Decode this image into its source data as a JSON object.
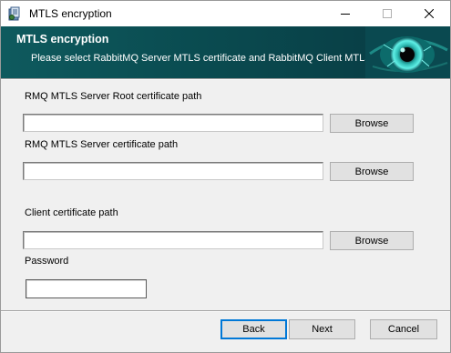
{
  "window": {
    "title": "MTLS encryption",
    "app_icon": "installer-icon",
    "controls": {
      "minimize": "minimize-icon",
      "maximize": "maximize-icon",
      "close": "close-icon"
    }
  },
  "banner": {
    "title": "MTLS encryption",
    "subtitle": "Please select RabbitMQ Server MTLS certificate and  RabbitMQ Client MTLS . .",
    "image": "eye-icon",
    "colors": {
      "background": "#0b5056",
      "accent": "#38e0d8"
    }
  },
  "form": {
    "server_root_cert": {
      "label": "RMQ MTLS Server Root certificate path",
      "value": "",
      "browse_label": "Browse"
    },
    "server_cert": {
      "label": "RMQ MTLS Server certificate path",
      "value": "",
      "browse_label": "Browse"
    },
    "client_cert": {
      "label": "Client certificate path",
      "value": "",
      "browse_label": "Browse"
    },
    "password": {
      "label": "Password",
      "value": ""
    }
  },
  "footer": {
    "back_label": "Back",
    "next_label": "Next",
    "cancel_label": "Cancel",
    "default_color": "#0078d7"
  }
}
